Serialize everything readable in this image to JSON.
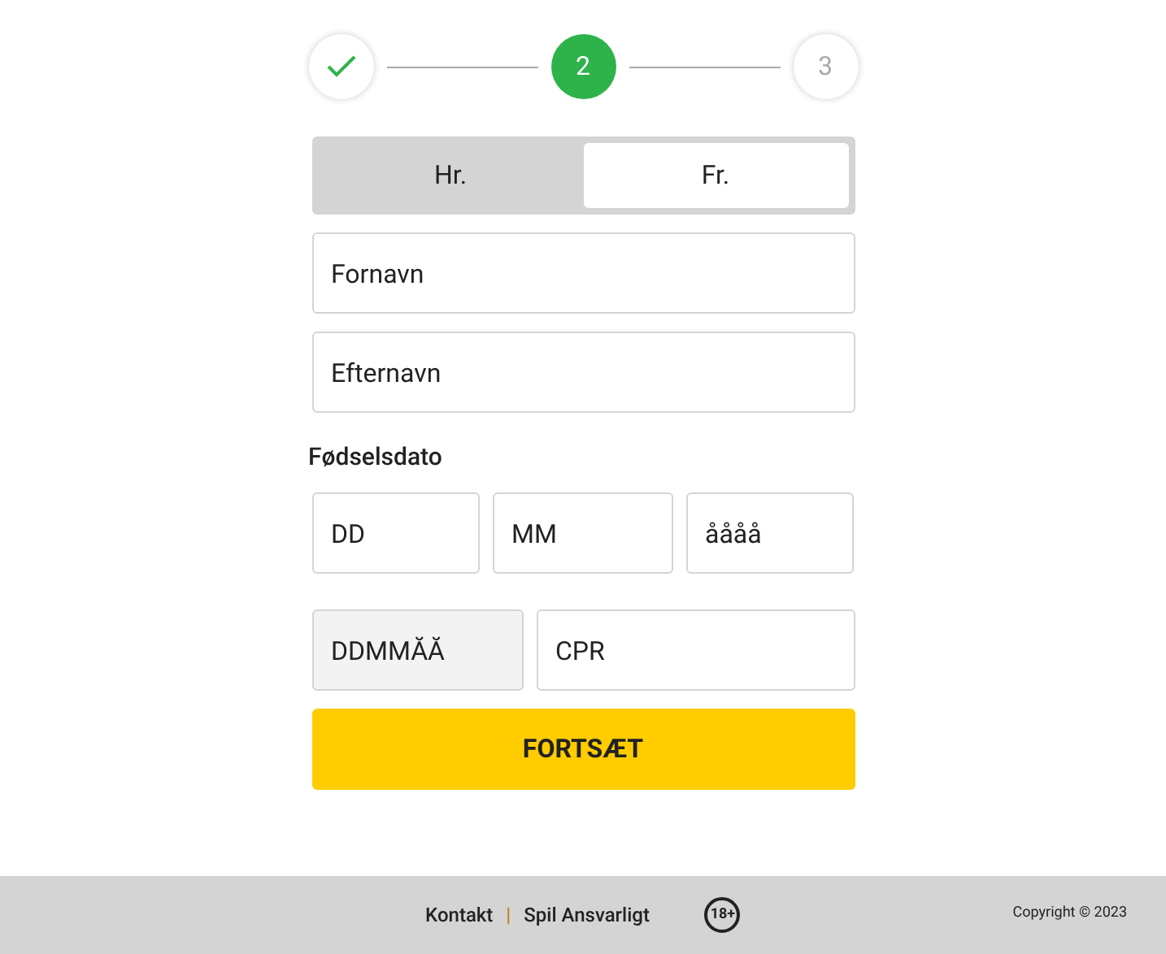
{
  "steps": [
    {
      "completed": true,
      "selected": false
    },
    {
      "completed": false,
      "selected": true,
      "label": "2"
    },
    {
      "completed": false,
      "selected": false,
      "label": "3"
    }
  ],
  "gender": [
    {
      "label": "Hr.",
      "selected": false
    },
    {
      "label": "Fr.",
      "selected": true
    }
  ],
  "name_fields": [
    {
      "placeholder": "Fornavn"
    },
    {
      "placeholder": "Efternavn"
    }
  ],
  "birthdate": {
    "label": "Fødselsdato",
    "fields": [
      {
        "placeholder": "DD"
      },
      {
        "placeholder": "MM"
      },
      {
        "placeholder": "åååå"
      }
    ]
  },
  "cpr": [
    {
      "placeholder": "DDMMĂĂ",
      "disabled": true
    },
    {
      "placeholder": "CPR",
      "disabled": false
    }
  ],
  "submit": "FORTSÆT",
  "footer": {
    "links": [
      "Kontakt",
      "Spil Ansvarligt"
    ],
    "separator": "|",
    "age_badge": "18+",
    "copyright": "Copyright © 2023"
  }
}
